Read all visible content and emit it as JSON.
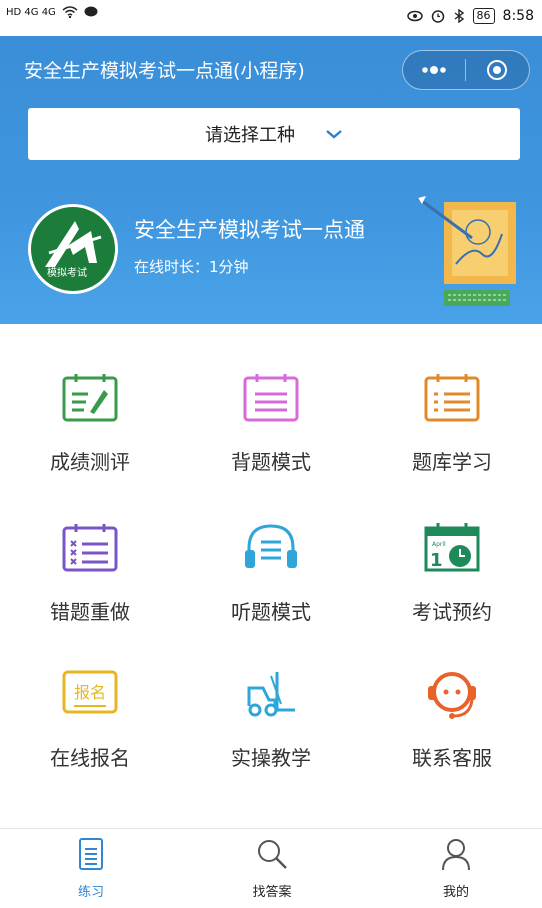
{
  "status": {
    "time": "8:58",
    "battery": "86",
    "left_info": "HD 4G 4G"
  },
  "header": {
    "title": "安全生产模拟考试一点通(小程序)",
    "select_placeholder": "请选择工种",
    "app_name": "安全生产模拟考试一点通",
    "online_time": "在线时长：1分钟",
    "logo_text": "模拟考试"
  },
  "menu": {
    "items": [
      {
        "label": "成绩测评",
        "icon": "score-report-icon",
        "color": "#3a9a4a"
      },
      {
        "label": "背题模式",
        "icon": "memorize-icon",
        "color": "#d76ad9"
      },
      {
        "label": "题库学习",
        "icon": "question-bank-icon",
        "color": "#e08a2a"
      },
      {
        "label": "错题重做",
        "icon": "wrong-redo-icon",
        "color": "#7a55c8"
      },
      {
        "label": "听题模式",
        "icon": "headphones-icon",
        "color": "#2fa6d9"
      },
      {
        "label": "考试预约",
        "icon": "calendar-clock-icon",
        "color": "#1e8a5a"
      },
      {
        "label": "在线报名",
        "icon": "signup-badge-icon",
        "color": "#e6b722"
      },
      {
        "label": "实操教学",
        "icon": "forklift-icon",
        "color": "#2fa6d9"
      },
      {
        "label": "联系客服",
        "icon": "customer-service-icon",
        "color": "#e8622a"
      }
    ],
    "signup_badge_text": "报名",
    "calendar_text": "April"
  },
  "tabbar": {
    "tabs": [
      {
        "label": "练习",
        "icon": "practice-icon",
        "active": true
      },
      {
        "label": "找答案",
        "icon": "search-icon",
        "active": false
      },
      {
        "label": "我的",
        "icon": "profile-icon",
        "active": false
      }
    ],
    "accent": "#2f86d6"
  }
}
